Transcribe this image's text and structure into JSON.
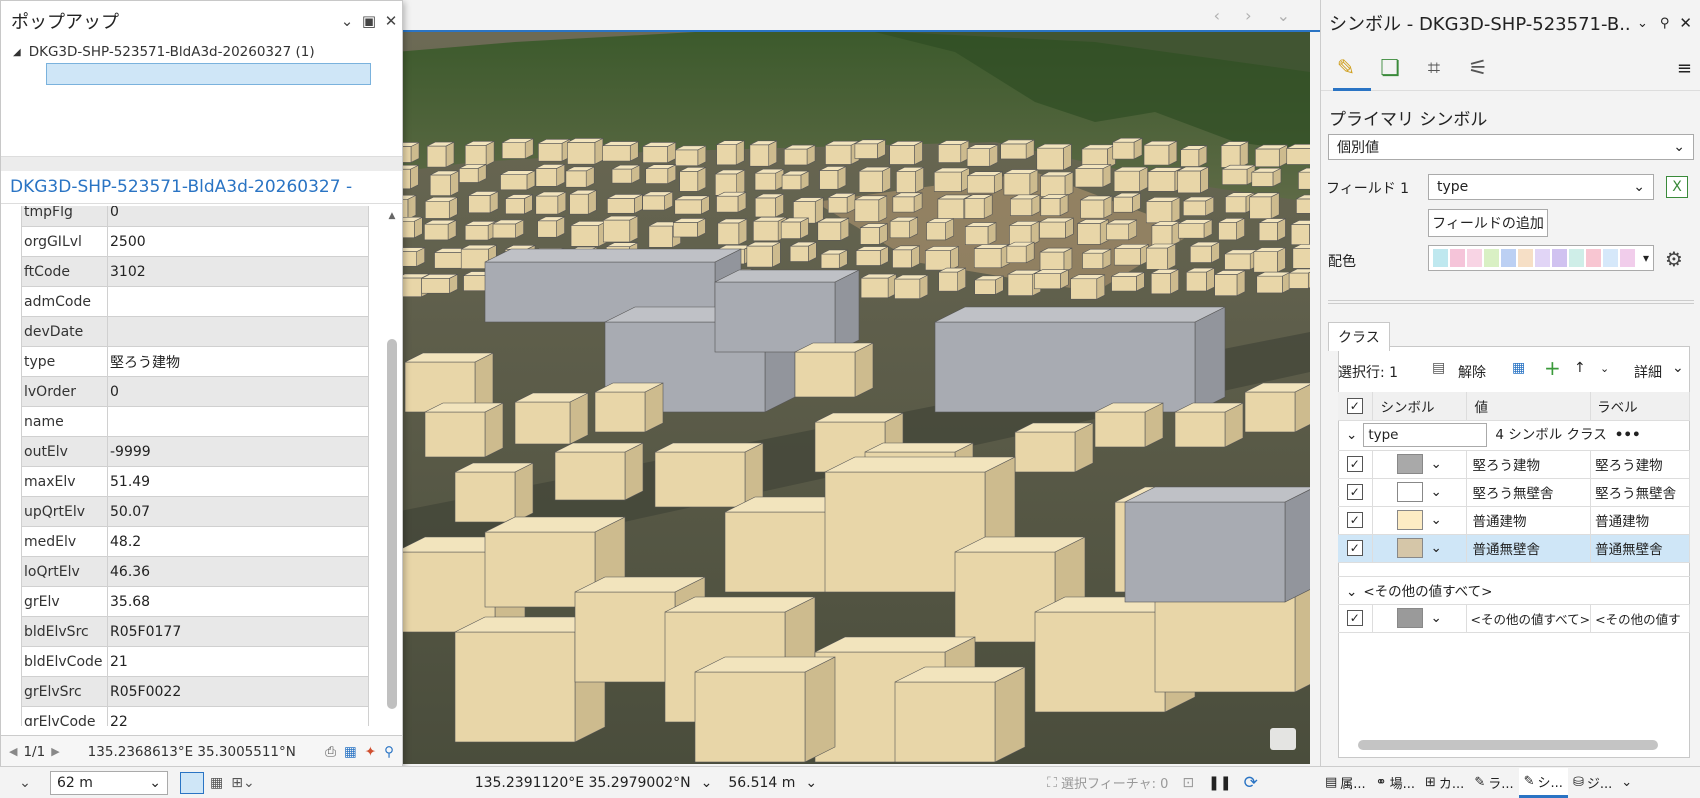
{
  "popup": {
    "title": "ポップアップ",
    "tree_node": "DKG3D-SHP-523571-BldA3d-20260327 (1)",
    "feature_header": "DKG3D-SHP-523571-BldA3d-20260327 -",
    "attributes": [
      {
        "key": "tmpFlg",
        "value": "0"
      },
      {
        "key": "orgGILvl",
        "value": "2500"
      },
      {
        "key": "ftCode",
        "value": "3102"
      },
      {
        "key": "admCode",
        "value": ""
      },
      {
        "key": "devDate",
        "value": ""
      },
      {
        "key": "type",
        "value": "堅ろう建物"
      },
      {
        "key": "lvOrder",
        "value": "0"
      },
      {
        "key": "name",
        "value": ""
      },
      {
        "key": "outElv",
        "value": "-9999"
      },
      {
        "key": "maxElv",
        "value": "51.49"
      },
      {
        "key": "upQrtElv",
        "value": "50.07"
      },
      {
        "key": "medElv",
        "value": "48.2"
      },
      {
        "key": "loQrtElv",
        "value": "46.36"
      },
      {
        "key": "grElv",
        "value": "35.68"
      },
      {
        "key": "bldElvSrc",
        "value": "R05F0177"
      },
      {
        "key": "bldElvCode",
        "value": "21"
      },
      {
        "key": "grElvSrc",
        "value": "R05F0022"
      },
      {
        "key": "grElvCode",
        "value": "22"
      }
    ],
    "footer_page": "1/1",
    "footer_coords": "135.2368613°E 35.3005511°N"
  },
  "statusbar": {
    "scale": "62 m",
    "coords": "135.2391120°E 35.2979002°N",
    "elevation": "56.514 m",
    "selected_features": "選択フィーチャ: 0"
  },
  "pane": {
    "title": "シンボル - DKG3D-SHP-523571-B...",
    "primary_symbol": "プライマリ シンボル",
    "method": "個別値",
    "field1_label": "フィールド 1",
    "field1_value": "type",
    "add_field": "フィールドの追加",
    "color_label": "配色",
    "classes_tab": "クラス",
    "selected_rows": "選択行: 1",
    "clear": "解除",
    "details": "詳細",
    "col_symbol": "シンボル",
    "col_value": "値",
    "col_label": "ラベル",
    "group_field": "type",
    "group_count": "4 シンボル クラス",
    "classes": [
      {
        "value": "堅ろう建物",
        "label": "堅ろう建物",
        "color": "#a9a9a9"
      },
      {
        "value": "堅ろう無壁舎",
        "label": "堅ろう無壁舎",
        "color": "#ffffff"
      },
      {
        "value": "普通建物",
        "label": "普通建物",
        "color": "#fdecc4"
      },
      {
        "value": "普通無壁舎",
        "label": "普通無壁舎",
        "color": "#d5c6a8"
      }
    ],
    "other_group": "<その他の値すべて>",
    "other_value": "<その他の値すべて>",
    "other_label": "<その他の値す",
    "bottom_tabs": [
      "属...",
      "場...",
      "カ...",
      "ラ...",
      "シ...",
      "ジ..."
    ]
  },
  "colors": {
    "accent": "#2a74c4",
    "building": "#e8d6a8",
    "building_gray": "#a8abb2"
  }
}
